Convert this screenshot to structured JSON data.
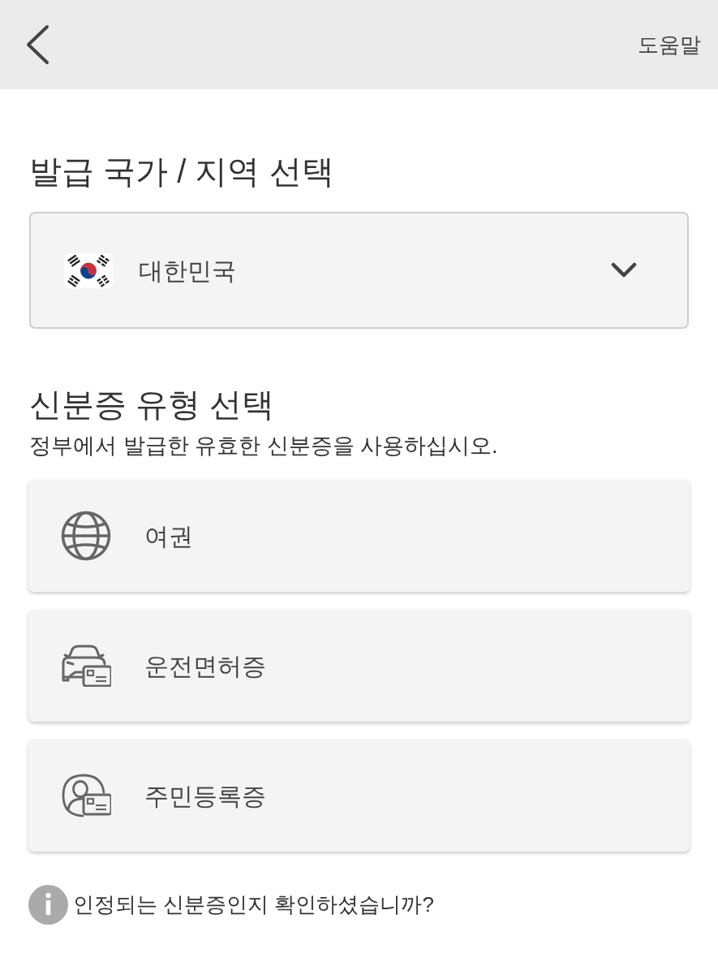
{
  "header": {
    "help": "도움말"
  },
  "country_section": {
    "title": "발급 국가 / 지역 선택",
    "selected_country": "대한민국"
  },
  "id_section": {
    "title": "신분증 유형 선택",
    "subtitle": "정부에서 발급한 유효한 신분증을 사용하십시오.",
    "options": [
      {
        "kind": "globe",
        "label": "여권"
      },
      {
        "kind": "car",
        "label": "운전면허증"
      },
      {
        "kind": "person",
        "label": "주민등록증"
      }
    ]
  },
  "info": {
    "text": "인정되는 신분증인지 확인하셨습니까?"
  }
}
